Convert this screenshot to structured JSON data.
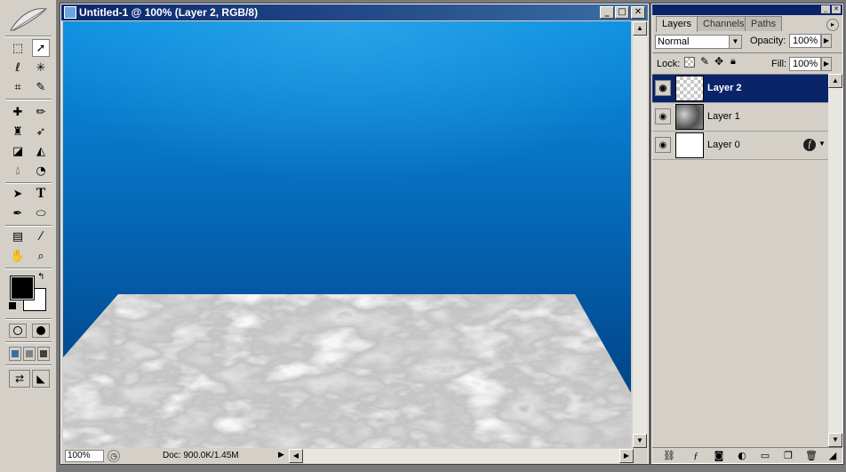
{
  "document": {
    "title": "Untitled-1 @ 100% (Layer 2, RGB/8)",
    "zoom": "100%",
    "doc_info": "Doc: 900.0K/1.45M"
  },
  "window_buttons": {
    "minimize": "_",
    "maximize": "□",
    "close": "✕"
  },
  "layers_palette": {
    "tabs": [
      "Layers",
      "Channels",
      "Paths"
    ],
    "blend_mode": "Normal",
    "opacity_label": "Opacity:",
    "opacity_value": "100%",
    "lock_label": "Lock:",
    "fill_label": "Fill:",
    "fill_value": "100%",
    "layers": [
      {
        "name": "Layer 2",
        "active": true,
        "thumb": "transparent"
      },
      {
        "name": "Layer 1",
        "active": false,
        "thumb": "clouds"
      },
      {
        "name": "Layer 0",
        "active": false,
        "thumb": "white"
      }
    ]
  },
  "toolbox": {
    "tools": [
      "marquee-tool",
      "move-tool",
      "lasso-tool",
      "magic-wand-tool",
      "crop-tool",
      "slice-tool",
      "healing-brush-tool",
      "brush-tool",
      "clone-stamp-tool",
      "history-brush-tool",
      "eraser-tool",
      "paint-bucket-tool",
      "blur-tool",
      "dodge-tool",
      "path-selection-tool",
      "type-tool",
      "pen-tool",
      "shape-tool",
      "notes-tool",
      "eyedropper-tool",
      "hand-tool",
      "zoom-tool"
    ],
    "foreground_color": "#000000",
    "background_color": "#ffffff"
  },
  "colors": {
    "titlebar": "#0a246a",
    "chrome": "#d4d0c8",
    "canvas_top": "#0c8fe0",
    "canvas_bottom": "#003a78"
  }
}
